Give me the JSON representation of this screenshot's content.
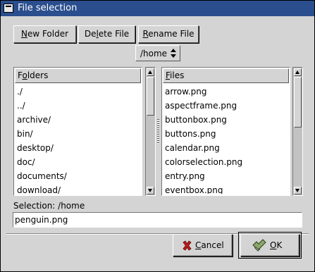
{
  "window": {
    "title": "File selection"
  },
  "buttons": {
    "new_folder": {
      "ul": "N",
      "rest": "ew Folder"
    },
    "delete_file": {
      "pre": "De",
      "ul": "l",
      "rest": "ete File"
    },
    "rename_file": {
      "ul": "R",
      "rest": "ename File"
    }
  },
  "path_combo": {
    "value": "/home"
  },
  "folders": {
    "header_ul": "o",
    "header_pre": "F",
    "header_rest": "lders",
    "items": [
      "./",
      "../",
      "archive/",
      "bin/",
      "desktop/",
      "doc/",
      "documents/",
      "download/"
    ]
  },
  "files": {
    "header_ul": "F",
    "header_rest": "iles",
    "items": [
      "arrow.png",
      "aspectframe.png",
      "buttonbox.png",
      "buttons.png",
      "calendar.png",
      "colorselection.png",
      "entry.png",
      "eventbox.png"
    ]
  },
  "selection": {
    "label": "Selection: /home",
    "value": "penguin.png"
  },
  "dialog_buttons": {
    "cancel": {
      "ul": "C",
      "rest": "ancel"
    },
    "ok": {
      "ul": "O",
      "rest": "K"
    }
  },
  "colors": {
    "titlebar": "#2a4e8e",
    "background": "#d4d4d4"
  }
}
